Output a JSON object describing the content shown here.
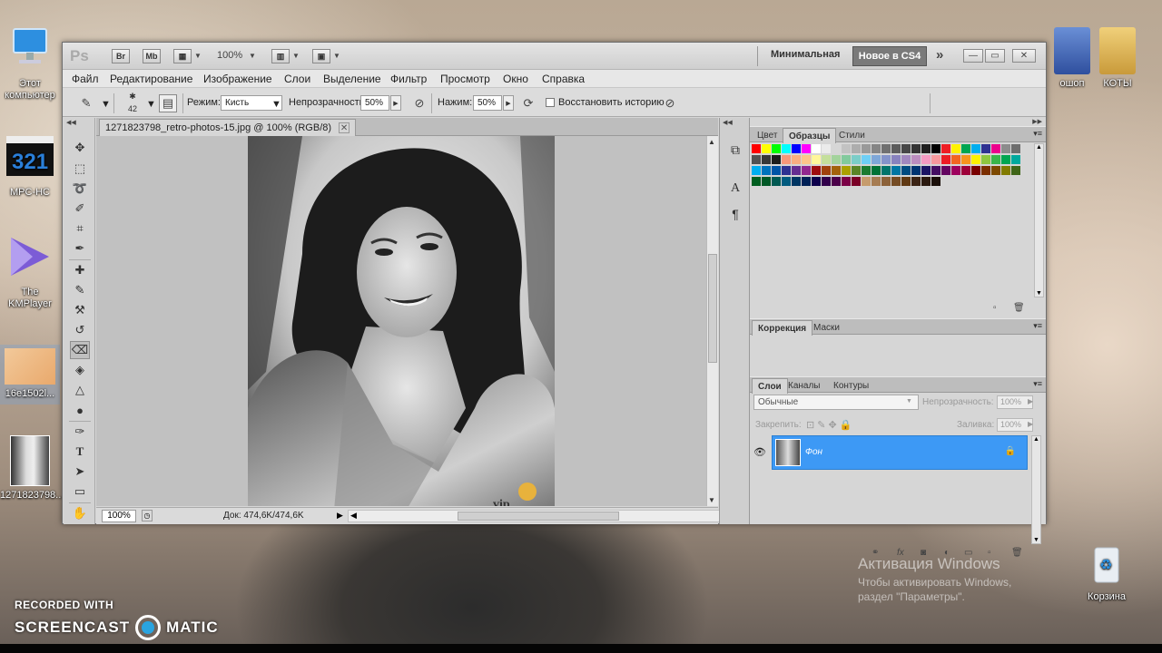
{
  "desktop": {
    "icons": [
      {
        "label": "Этот компьютер"
      },
      {
        "label": "MPC-HC"
      },
      {
        "label": "The KMPlayer"
      },
      {
        "label": "16e1502l..."
      },
      {
        "label": "1271823798..."
      },
      {
        "label": "ошоп"
      },
      {
        "label": "КОТЫ"
      },
      {
        "label": "Корзина"
      }
    ],
    "watermark": {
      "recorded_with": "RECORDED WITH",
      "brand_left": "SCREENCAST",
      "brand_right": "MATIC"
    },
    "activation": {
      "title": "Активация Windows",
      "line1": "Чтобы активировать Windows,",
      "line2": "раздел \"Параметры\"."
    }
  },
  "photoshop": {
    "logo": "Ps",
    "titlebar": {
      "bridge": "Br",
      "minibridge": "Mb",
      "zoom": "100%",
      "workspace_minimal": "Минимальная",
      "workspace_new": "Новое в CS4",
      "more": "»"
    },
    "menu": [
      "Файл",
      "Редактирование",
      "Изображение",
      "Слои",
      "Выделение",
      "Фильтр",
      "Просмотр",
      "Окно",
      "Справка"
    ],
    "options": {
      "brush_size": "42",
      "mode_label": "Режим:",
      "mode_value": "Кисть",
      "opacity_label": "Непрозрачность:",
      "opacity_value": "50%",
      "pressure_label": "Нажим:",
      "pressure_value": "50%",
      "restore_history": "Восстановить историю"
    },
    "document": {
      "tab_title": "1271823798_retro-photos-15.jpg @ 100% (RGB/8)",
      "zoom": "100%",
      "doc_info": "Док: 474,6K/474,6K"
    },
    "panels": {
      "swatches_tabs": [
        "Цвет",
        "Образцы",
        "Стили"
      ],
      "adjust_tabs": [
        "Коррекция",
        "Маски"
      ],
      "layers_tabs": [
        "Слои",
        "Каналы",
        "Контуры"
      ],
      "blend_mode": "Обычные",
      "opacity_label": "Непрозрачность:",
      "opacity_value": "100%",
      "lock_label": "Закрепить:",
      "fill_label": "Заливка:",
      "fill_value": "100%",
      "layer_name": "Фон"
    },
    "swatch_colors": [
      "#ff0000",
      "#ffff00",
      "#00ff00",
      "#00ffff",
      "#0000ff",
      "#ff00ff",
      "#ffffff",
      "#ebebeb",
      "#d6d6d6",
      "#c2c2c2",
      "#adadad",
      "#999999",
      "#858585",
      "#707070",
      "#5c5c5c",
      "#474747",
      "#333333",
      "#1f1f1f",
      "#000000",
      "#ee1d24",
      "#fff200",
      "#00a650",
      "#00aeef",
      "#2e3192",
      "#ec008c",
      "#8c8c8c",
      "#6e6e6e",
      "#525252",
      "#383838",
      "#1c1c1c",
      "#f7977a",
      "#f9ad81",
      "#fdc68a",
      "#fff79a",
      "#c4df9b",
      "#a3d39c",
      "#82ca9d",
      "#7bcdc8",
      "#6ecff6",
      "#7ea7d8",
      "#8493ca",
      "#8882be",
      "#a187be",
      "#bc8dbf",
      "#f49ac2",
      "#f6989d",
      "#ed1c24",
      "#f26522",
      "#f7941d",
      "#fff200",
      "#8dc63f",
      "#39b54a",
      "#00a651",
      "#00a99d",
      "#00aeef",
      "#0072bc",
      "#0054a6",
      "#2e3192",
      "#662d91",
      "#92278f",
      "#9e0b0f",
      "#a0410d",
      "#a3620a",
      "#aba000",
      "#598527",
      "#1a7b30",
      "#007236",
      "#00746b",
      "#0076a3",
      "#004b80",
      "#003471",
      "#1b1464",
      "#440e62",
      "#630460",
      "#9e005d",
      "#9e0039",
      "#790000",
      "#7b2e00",
      "#7d4900",
      "#827b00",
      "#406618",
      "#005e20",
      "#005826",
      "#005952",
      "#005b7f",
      "#003663",
      "#002157",
      "#0d004c",
      "#32004b",
      "#4b0049",
      "#7b0046",
      "#7a0026",
      "#c69c6d",
      "#a67c52",
      "#8c6239",
      "#754c24",
      "#603913",
      "#3c2415",
      "#2b1a10",
      "#1a0f09"
    ]
  }
}
